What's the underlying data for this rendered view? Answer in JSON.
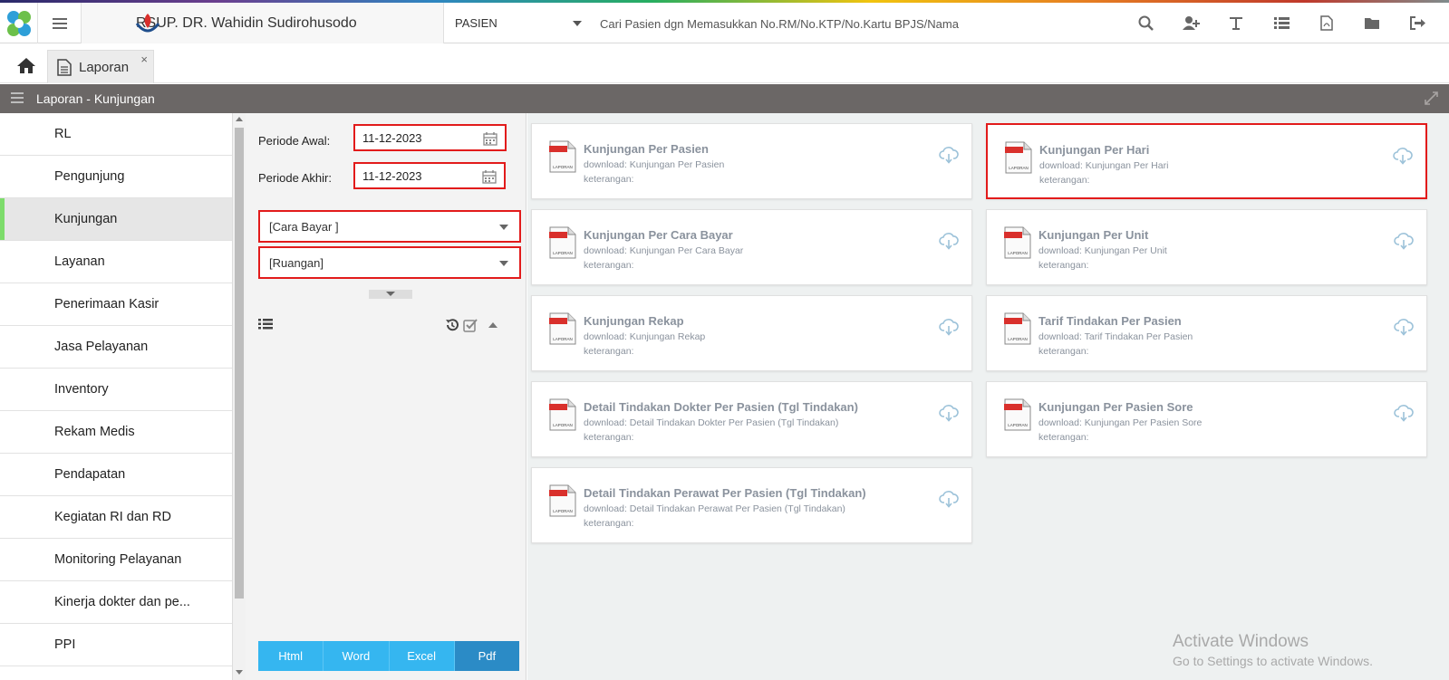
{
  "header": {
    "hospital_name": "RSUP. DR. Wahidin Sudirohusodo",
    "search_type": "PASIEN",
    "search_placeholder": "Cari Pasien dgn Memasukkan No.RM/No.KTP/No.Kartu BPJS/Nama",
    "icons": [
      "search-icon",
      "add-user-icon",
      "text-icon",
      "list-icon",
      "pdf-icon",
      "folder-icon",
      "logout-icon"
    ]
  },
  "tabs": [
    {
      "label": "Laporan",
      "close": "×"
    }
  ],
  "section_title": "Laporan - Kunjungan",
  "sidebar": {
    "active": "Kunjungan",
    "items": [
      {
        "label": "RL"
      },
      {
        "label": "Pengunjung"
      },
      {
        "label": "Kunjungan"
      },
      {
        "label": "Layanan"
      },
      {
        "label": "Penerimaan Kasir"
      },
      {
        "label": "Jasa Pelayanan"
      },
      {
        "label": "Inventory"
      },
      {
        "label": "Rekam Medis"
      },
      {
        "label": "Pendapatan"
      },
      {
        "label": "Kegiatan RI dan RD"
      },
      {
        "label": "Monitoring Pelayanan"
      },
      {
        "label": "Kinerja dokter dan pe..."
      },
      {
        "label": "PPI"
      }
    ]
  },
  "filter": {
    "periode_awal_label": "Periode Awal:",
    "periode_awal_value": "11-12-2023",
    "periode_akhir_label": "Periode Akhir:",
    "periode_akhir_value": "11-12-2023",
    "cara_bayar": "[Cara Bayar ]",
    "ruangan": "[Ruangan]",
    "export_buttons": [
      "Html",
      "Word",
      "Excel",
      "Pdf"
    ],
    "export_selected": "Pdf"
  },
  "reports": [
    {
      "title": "Kunjungan Per Pasien",
      "download": "download: Kunjungan Per Pasien",
      "keterangan": "keterangan:",
      "highlighted": false
    },
    {
      "title": "Kunjungan Per Hari",
      "download": "download: Kunjungan Per Hari",
      "keterangan": "keterangan:",
      "highlighted": true
    },
    {
      "title": "Kunjungan Per Cara Bayar",
      "download": "download: Kunjungan Per Cara Bayar",
      "keterangan": "keterangan:",
      "highlighted": false
    },
    {
      "title": "Kunjungan Per Unit",
      "download": "download: Kunjungan Per Unit",
      "keterangan": "keterangan:",
      "highlighted": false
    },
    {
      "title": "Kunjungan Rekap",
      "download": "download: Kunjungan Rekap",
      "keterangan": "keterangan:",
      "highlighted": false
    },
    {
      "title": "Tarif Tindakan Per Pasien",
      "download": "download: Tarif Tindakan Per Pasien",
      "keterangan": "keterangan:",
      "highlighted": false
    },
    {
      "title": "Detail Tindakan Dokter Per Pasien (Tgl Tindakan)",
      "download": "download: Detail Tindakan Dokter Per Pasien (Tgl Tindakan)",
      "keterangan": "keterangan:",
      "highlighted": false
    },
    {
      "title": "Kunjungan Per Pasien Sore",
      "download": "download: Kunjungan Per Pasien Sore",
      "keterangan": "keterangan:",
      "highlighted": false
    },
    {
      "title": "Detail Tindakan Perawat Per Pasien (Tgl Tindakan)",
      "download": "download: Detail Tindakan Perawat Per Pasien (Tgl Tindakan)",
      "keterangan": "keterangan:",
      "highlighted": false
    }
  ],
  "doc_icon_label": "LAPORAN",
  "watermark": {
    "line1": "Activate Windows",
    "line2": "Go to Settings to activate Windows."
  },
  "colors": {
    "highlight": "#e21b1b",
    "titlebar": "#6b6766",
    "export_button": "#35b6f0",
    "export_selected": "#2b8bc6",
    "active_marker": "#7ddc6b"
  }
}
